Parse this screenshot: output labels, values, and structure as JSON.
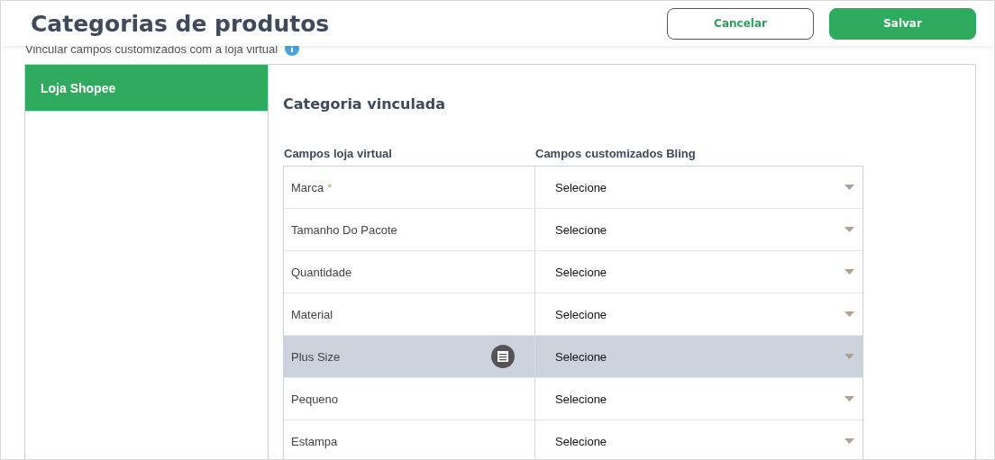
{
  "header": {
    "title": "Categorias de produtos",
    "buttons": [
      {
        "label": "Cancelar",
        "kind": "secondary"
      },
      {
        "label": "Salvar",
        "kind": "primary"
      }
    ]
  },
  "subtitle": "Vincular campos customizados com a loja virtual",
  "sidebar": {
    "items": [
      {
        "label": "Loja Shopee",
        "selected": true
      }
    ]
  },
  "section_title": "Categoria vinculada",
  "table": {
    "columns": [
      "Campos loja virtual",
      "Campos customizados Bling"
    ],
    "rows": [
      {
        "field": "Marca",
        "required_mark": "*",
        "highlighted": false,
        "value": "Selecione"
      },
      {
        "field": "Tamanho Do Pacote",
        "highlighted": false,
        "value": "Selecione"
      },
      {
        "field": "Quantidade",
        "highlighted": false,
        "value": "Selecione"
      },
      {
        "field": "Material",
        "highlighted": false,
        "value": "Selecione"
      },
      {
        "field": "Plus Size",
        "highlighted": true,
        "value": "Selecione"
      },
      {
        "field": "Pequeno",
        "highlighted": false,
        "value": "Selecione"
      },
      {
        "field": "Estampa",
        "highlighted": false,
        "value": "Selecione"
      }
    ]
  }
}
